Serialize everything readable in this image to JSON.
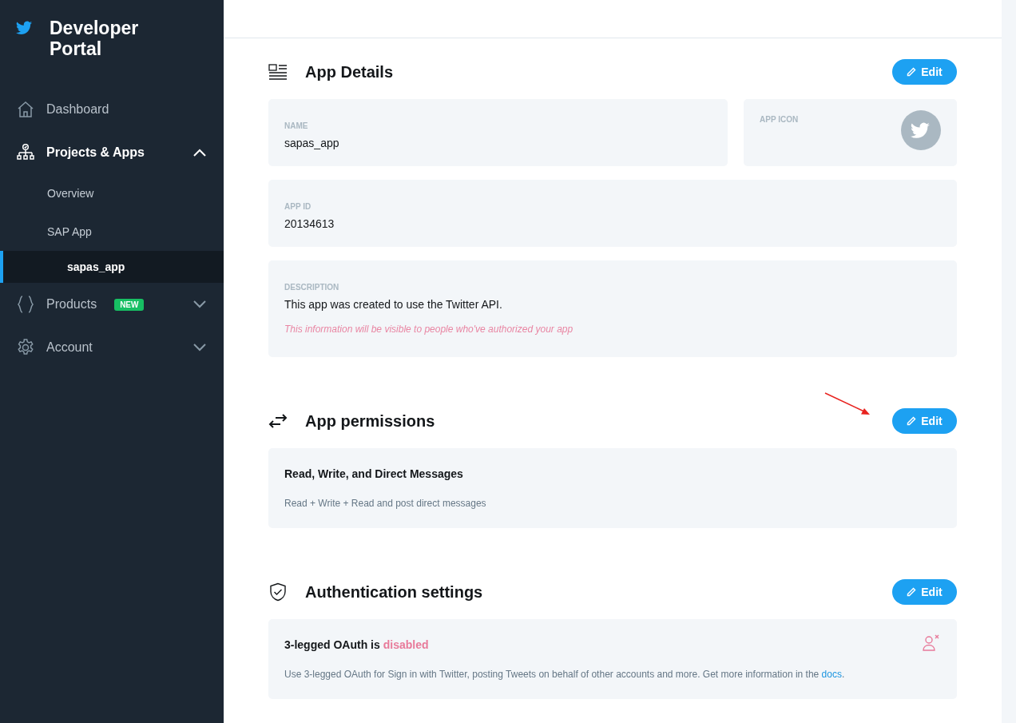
{
  "sidebar": {
    "logo_title": "Developer Portal",
    "nav": [
      {
        "label": "Dashboard",
        "kind": "item"
      },
      {
        "label": "Projects & Apps",
        "kind": "group",
        "expanded": true,
        "children": [
          {
            "label": "Overview",
            "selected": false
          },
          {
            "label": "SAP App",
            "selected": false,
            "children": [
              {
                "label": "sapas_app",
                "selected": true
              }
            ]
          }
        ]
      },
      {
        "label": "Products",
        "kind": "group",
        "expanded": false,
        "badge": "NEW"
      },
      {
        "label": "Account",
        "kind": "group",
        "expanded": false
      }
    ]
  },
  "sections": [
    {
      "kind": "details",
      "title": "App Details",
      "button": "Edit",
      "name": {
        "label": "NAME",
        "value": "sapas_app"
      },
      "app_icon": {
        "label": "APP ICON"
      },
      "app_id": {
        "label": "APP ID",
        "value": "20134613"
      },
      "description": {
        "label": "DESCRIPTION",
        "value": "This app was created to use the Twitter API.",
        "note": "This information will be visible to people who've authorized your app"
      }
    },
    {
      "kind": "permissions",
      "title": "App permissions",
      "button": "Edit",
      "heading": "Read, Write, and Direct Messages",
      "text": "Read + Write + Read and post direct messages"
    },
    {
      "kind": "auth",
      "title": "Authentication settings",
      "button": "Edit",
      "heading": "3-legged OAuth is",
      "status": "disabled",
      "enabled": false,
      "text": "Use 3-legged OAuth for Sign in with Twitter, posting Tweets on behalf of other accounts and more. Get more information in the",
      "link": "docs",
      "text_end": "."
    }
  ]
}
